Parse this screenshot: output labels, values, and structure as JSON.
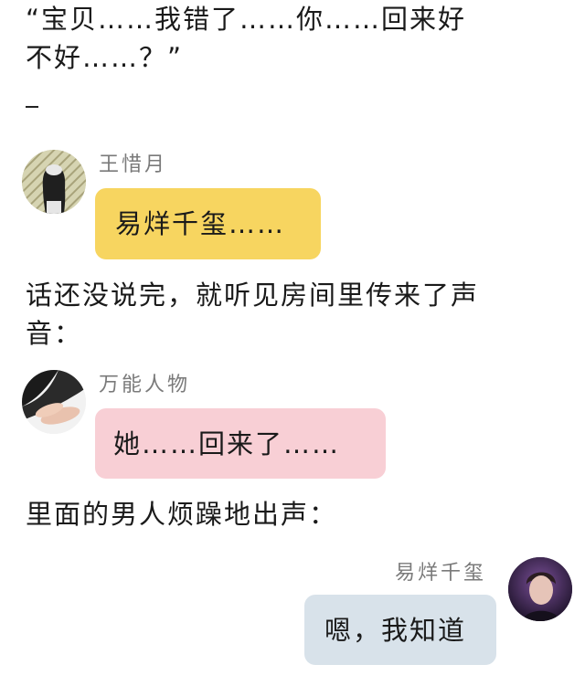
{
  "story": {
    "para1_line1": "“宝贝……我错了……你……回来好",
    "para1_line2": "不好……？”",
    "dash": "_",
    "para2_line1": "话还没说完，就听见房间里传来了声",
    "para2_line2": "音：",
    "para3": "里面的男人烦躁地出声："
  },
  "messages": [
    {
      "sender": "王惜月",
      "text": "易烊千玺……",
      "side": "left",
      "bubble_color": "#f7d560"
    },
    {
      "sender": "万能人物",
      "text": "她……回来了……",
      "side": "left",
      "bubble_color": "#f8cfd5"
    },
    {
      "sender": "易烊千玺",
      "text": "嗯，我知道",
      "side": "right",
      "bubble_color": "#d8e2ea"
    }
  ]
}
